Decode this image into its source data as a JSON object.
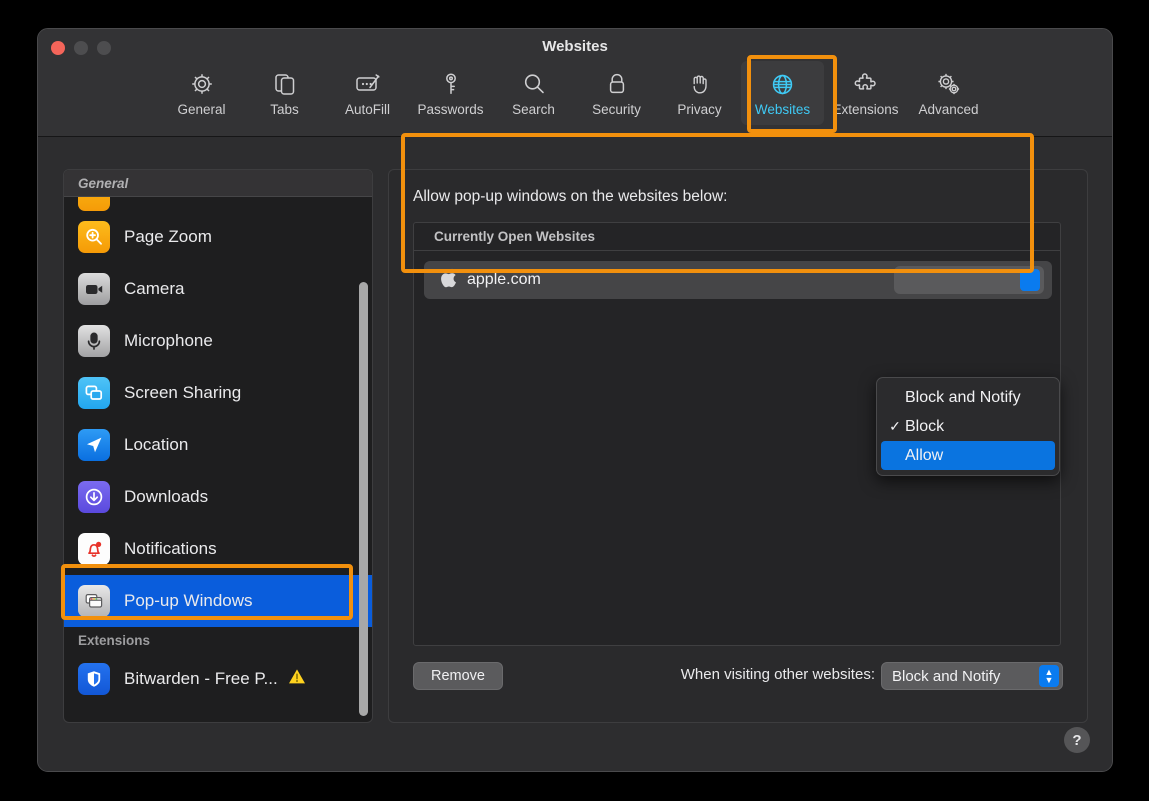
{
  "window": {
    "title": "Websites",
    "traffic_lights": [
      "close-red",
      "minimize-gray",
      "zoom-gray"
    ]
  },
  "toolbar": {
    "items": [
      {
        "label": "General",
        "icon": "gear-icon",
        "selected": false
      },
      {
        "label": "Tabs",
        "icon": "tabs-icon",
        "selected": false
      },
      {
        "label": "AutoFill",
        "icon": "autofill-icon",
        "selected": false
      },
      {
        "label": "Passwords",
        "icon": "key-icon",
        "selected": false
      },
      {
        "label": "Search",
        "icon": "magnifier-icon",
        "selected": false
      },
      {
        "label": "Security",
        "icon": "lock-icon",
        "selected": false
      },
      {
        "label": "Privacy",
        "icon": "hand-icon",
        "selected": false
      },
      {
        "label": "Websites",
        "icon": "globe-icon",
        "selected": true
      },
      {
        "label": "Extensions",
        "icon": "puzzle-icon",
        "selected": false
      },
      {
        "label": "Advanced",
        "icon": "gears-icon",
        "selected": false
      }
    ],
    "selected_accent": "#3fc9f4"
  },
  "sidebar": {
    "group_general": "General",
    "group_extensions": "Extensions",
    "items": [
      {
        "label": "Page Zoom",
        "icon": "page-zoom-icon",
        "selected": false
      },
      {
        "label": "Camera",
        "icon": "camera-icon",
        "selected": false
      },
      {
        "label": "Microphone",
        "icon": "microphone-icon",
        "selected": false
      },
      {
        "label": "Screen Sharing",
        "icon": "screen-sharing-icon",
        "selected": false
      },
      {
        "label": "Location",
        "icon": "location-icon",
        "selected": false
      },
      {
        "label": "Downloads",
        "icon": "downloads-icon",
        "selected": false
      },
      {
        "label": "Notifications",
        "icon": "notifications-icon",
        "selected": false
      },
      {
        "label": "Pop-up Windows",
        "icon": "popup-windows-icon",
        "selected": true
      }
    ],
    "extensions": [
      {
        "label": "Bitwarden - Free P...",
        "icon": "bitwarden-shield-icon",
        "badge": "warning-triangle-icon"
      }
    ],
    "selected_color": "#0a5ddc"
  },
  "main": {
    "heading": "Allow pop-up windows on the websites below:",
    "table": {
      "column_header": "Currently Open Websites",
      "rows": [
        {
          "site": "apple.com",
          "icon": "apple-logo-icon",
          "setting": "Block"
        }
      ]
    },
    "remove_button": "Remove",
    "visiting_label": "When visiting other websites:",
    "visiting_value": "Block and Notify"
  },
  "context_menu": {
    "items": [
      {
        "label": "Block and Notify",
        "checked": false,
        "highlighted": false
      },
      {
        "label": "Block",
        "checked": true,
        "highlighted": false
      },
      {
        "label": "Allow",
        "checked": false,
        "highlighted": true
      }
    ],
    "check_glyph": "✓",
    "highlight_color": "#0a74e0"
  },
  "help_button": "?",
  "annotations": {
    "color": "#f2900d",
    "regions": [
      "websites-tab",
      "websites-table",
      "popup-windows-sidebar-item"
    ]
  }
}
